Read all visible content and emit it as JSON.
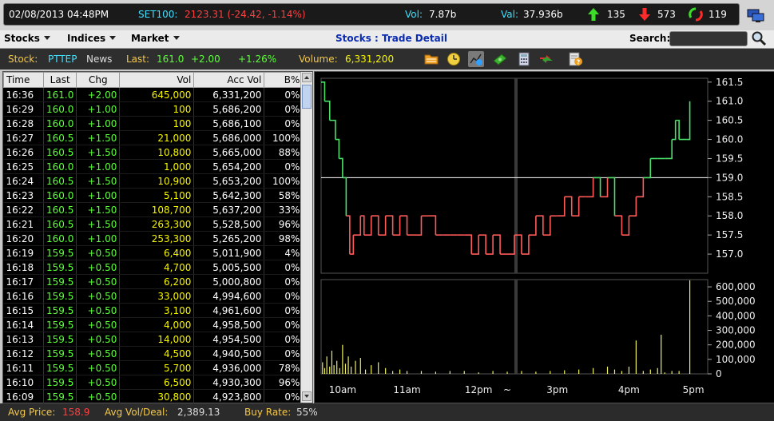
{
  "ticker": {
    "datetime": "02/08/2013 04:48PM",
    "index_label": "SET100:",
    "index_value": "2123.31 (-24.42, -1.14%)",
    "vol_label": "Vol:",
    "vol_value": "7.87b",
    "val_label": "Val:",
    "val_value": "37.936b",
    "up_count": "135",
    "down_count": "573",
    "unchanged_count": "119"
  },
  "menu": {
    "stocks": "Stocks",
    "indices": "Indices",
    "market": "Market",
    "page_title": "Stocks : Trade Detail",
    "search_label": "Search:",
    "search_value": ""
  },
  "stockbar": {
    "stock_label": "Stock:",
    "symbol": "PTTEP",
    "news": "News",
    "last_label": "Last:",
    "last_value": "161.0",
    "change": "+2.00",
    "pct": "+1.26%",
    "volume_label": "Volume:",
    "volume_value": "6,331,200",
    "toolbar_icons": [
      "folder-icon",
      "clock-icon",
      "chart-icon",
      "money-icon",
      "calculator-icon",
      "transfer-icon",
      "help-icon"
    ]
  },
  "table": {
    "headers": [
      "Time",
      "Last",
      "Chg",
      "Vol",
      "Acc Vol",
      "B%"
    ],
    "rows": [
      [
        "16:36",
        "161.0",
        "+2.00",
        "645,000",
        "6,331,200",
        "0%"
      ],
      [
        "16:29",
        "160.0",
        "+1.00",
        "100",
        "5,686,200",
        "0%"
      ],
      [
        "16:28",
        "160.0",
        "+1.00",
        "100",
        "5,686,100",
        "0%"
      ],
      [
        "16:27",
        "160.5",
        "+1.50",
        "21,000",
        "5,686,000",
        "100%"
      ],
      [
        "16:26",
        "160.5",
        "+1.50",
        "10,800",
        "5,665,000",
        "88%"
      ],
      [
        "16:25",
        "160.0",
        "+1.00",
        "1,000",
        "5,654,200",
        "0%"
      ],
      [
        "16:24",
        "160.5",
        "+1.50",
        "10,900",
        "5,653,200",
        "100%"
      ],
      [
        "16:23",
        "160.0",
        "+1.00",
        "5,100",
        "5,642,300",
        "58%"
      ],
      [
        "16:22",
        "160.5",
        "+1.50",
        "108,700",
        "5,637,200",
        "33%"
      ],
      [
        "16:21",
        "160.5",
        "+1.50",
        "263,300",
        "5,528,500",
        "96%"
      ],
      [
        "16:20",
        "160.0",
        "+1.00",
        "253,300",
        "5,265,200",
        "98%"
      ],
      [
        "16:19",
        "159.5",
        "+0.50",
        "6,400",
        "5,011,900",
        "4%"
      ],
      [
        "16:18",
        "159.5",
        "+0.50",
        "4,700",
        "5,005,500",
        "0%"
      ],
      [
        "16:17",
        "159.5",
        "+0.50",
        "6,200",
        "5,000,800",
        "0%"
      ],
      [
        "16:16",
        "159.5",
        "+0.50",
        "33,000",
        "4,994,600",
        "0%"
      ],
      [
        "16:15",
        "159.5",
        "+0.50",
        "3,100",
        "4,961,600",
        "0%"
      ],
      [
        "16:14",
        "159.5",
        "+0.50",
        "4,000",
        "4,958,500",
        "0%"
      ],
      [
        "16:13",
        "159.5",
        "+0.50",
        "14,000",
        "4,954,500",
        "0%"
      ],
      [
        "16:12",
        "159.5",
        "+0.50",
        "4,500",
        "4,940,500",
        "0%"
      ],
      [
        "16:11",
        "159.5",
        "+0.50",
        "5,700",
        "4,936,000",
        "78%"
      ],
      [
        "16:10",
        "159.5",
        "+0.50",
        "6,500",
        "4,930,300",
        "96%"
      ],
      [
        "16:09",
        "159.5",
        "+0.50",
        "30,800",
        "4,923,800",
        "0%"
      ]
    ]
  },
  "chart_data": {
    "type": "line",
    "price_ylim": [
      156.5,
      161.6
    ],
    "price_ticks": [
      "161.5",
      "161.0",
      "160.5",
      "160.0",
      "159.5",
      "159.0",
      "158.5",
      "158.0",
      "157.5",
      "157.0"
    ],
    "price_tick_values": [
      161.5,
      161.0,
      160.5,
      160.0,
      159.5,
      159.0,
      158.5,
      158.0,
      157.5,
      157.0
    ],
    "prev_close": 159.0,
    "x_labels": [
      "10am",
      "11am",
      "12pm",
      "~",
      "3pm",
      "4pm",
      "5pm"
    ],
    "time_markers": [
      0.3,
      1.2,
      2.2,
      2.6,
      3.3,
      4.3,
      5.2
    ],
    "price_series": [
      [
        0.0,
        161.5
      ],
      [
        0.05,
        161.0
      ],
      [
        0.12,
        160.5
      ],
      [
        0.2,
        160.0
      ],
      [
        0.25,
        159.5
      ],
      [
        0.3,
        159.0
      ],
      [
        0.35,
        158.0
      ],
      [
        0.4,
        157.0
      ],
      [
        0.45,
        157.5
      ],
      [
        0.55,
        158.0
      ],
      [
        0.6,
        157.5
      ],
      [
        0.7,
        158.0
      ],
      [
        0.8,
        157.5
      ],
      [
        0.9,
        158.0
      ],
      [
        1.0,
        157.5
      ],
      [
        1.1,
        158.0
      ],
      [
        1.2,
        157.5
      ],
      [
        1.3,
        157.5
      ],
      [
        1.4,
        158.0
      ],
      [
        1.5,
        158.0
      ],
      [
        1.6,
        157.5
      ],
      [
        1.7,
        157.5
      ],
      [
        1.8,
        157.5
      ],
      [
        1.9,
        157.5
      ],
      [
        2.0,
        157.5
      ],
      [
        2.1,
        157.0
      ],
      [
        2.2,
        157.5
      ],
      [
        2.3,
        157.0
      ],
      [
        2.4,
        157.5
      ],
      [
        2.5,
        157.0
      ],
      [
        2.6,
        157.0
      ],
      [
        2.7,
        157.5
      ],
      [
        2.8,
        157.0
      ],
      [
        2.9,
        157.5
      ],
      [
        3.0,
        158.0
      ],
      [
        3.1,
        157.5
      ],
      [
        3.2,
        158.0
      ],
      [
        3.3,
        158.0
      ],
      [
        3.4,
        158.5
      ],
      [
        3.5,
        158.0
      ],
      [
        3.6,
        158.5
      ],
      [
        3.7,
        158.5
      ],
      [
        3.8,
        159.0
      ],
      [
        3.9,
        158.5
      ],
      [
        4.0,
        159.0
      ],
      [
        4.1,
        158.0
      ],
      [
        4.2,
        157.5
      ],
      [
        4.3,
        158.0
      ],
      [
        4.4,
        158.5
      ],
      [
        4.5,
        159.0
      ],
      [
        4.6,
        159.5
      ],
      [
        4.7,
        159.5
      ],
      [
        4.8,
        159.5
      ],
      [
        4.9,
        160.0
      ],
      [
        4.95,
        160.5
      ],
      [
        5.0,
        160.0
      ],
      [
        5.1,
        160.0
      ],
      [
        5.15,
        161.0
      ]
    ],
    "volume_ylim": [
      0,
      650000
    ],
    "volume_ticks": [
      "600,000",
      "500,000",
      "400,000",
      "300,000",
      "200,000",
      "100,000",
      "0"
    ],
    "volume_tick_values": [
      600000,
      500000,
      400000,
      300000,
      200000,
      100000,
      0
    ],
    "volume_series": [
      [
        0.02,
        80000
      ],
      [
        0.05,
        40000
      ],
      [
        0.08,
        120000
      ],
      [
        0.12,
        50000
      ],
      [
        0.15,
        160000
      ],
      [
        0.18,
        60000
      ],
      [
        0.22,
        90000
      ],
      [
        0.26,
        40000
      ],
      [
        0.3,
        200000
      ],
      [
        0.34,
        70000
      ],
      [
        0.38,
        120000
      ],
      [
        0.42,
        50000
      ],
      [
        0.48,
        90000
      ],
      [
        0.55,
        110000
      ],
      [
        0.62,
        30000
      ],
      [
        0.7,
        60000
      ],
      [
        0.8,
        80000
      ],
      [
        0.9,
        40000
      ],
      [
        1.0,
        20000
      ],
      [
        1.1,
        30000
      ],
      [
        1.2,
        20000
      ],
      [
        1.4,
        20000
      ],
      [
        1.6,
        15000
      ],
      [
        1.8,
        20000
      ],
      [
        2.0,
        20000
      ],
      [
        2.2,
        10000
      ],
      [
        2.4,
        20000
      ],
      [
        2.6,
        15000
      ],
      [
        2.8,
        20000
      ],
      [
        3.0,
        15000
      ],
      [
        3.2,
        20000
      ],
      [
        3.4,
        25000
      ],
      [
        3.6,
        30000
      ],
      [
        3.8,
        40000
      ],
      [
        4.0,
        50000
      ],
      [
        4.1,
        30000
      ],
      [
        4.2,
        20000
      ],
      [
        4.3,
        50000
      ],
      [
        4.4,
        230000
      ],
      [
        4.5,
        20000
      ],
      [
        4.6,
        30000
      ],
      [
        4.7,
        40000
      ],
      [
        4.75,
        270000
      ],
      [
        4.8,
        10000
      ],
      [
        4.9,
        20000
      ],
      [
        5.0,
        20000
      ],
      [
        5.15,
        645000
      ]
    ]
  },
  "status": {
    "avg_price_label": "Avg Price:",
    "avg_price": "158.9",
    "avg_vol_label": "Avg Vol/Deal:",
    "avg_vol": "2,389.13",
    "buy_rate_label": "Buy Rate:",
    "buy_rate": "55%"
  },
  "colors": {
    "up": "#5cff3a",
    "down": "#ff4040",
    "yellow": "#f5f500",
    "cyan": "#40e0ff",
    "title_blue": "#0a2bb0",
    "chart_up": "#4ce06a",
    "chart_down": "#ff5a5a"
  }
}
